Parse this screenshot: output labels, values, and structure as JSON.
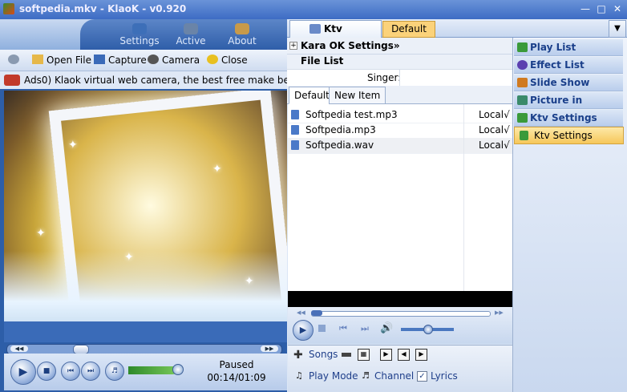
{
  "window": {
    "title": "softpedia.mkv - KlaoK - v0.920"
  },
  "nav_tabs": [
    {
      "label": "Settings"
    },
    {
      "label": "Active"
    },
    {
      "label": "About"
    }
  ],
  "toolbar": {
    "open_file": "Open File",
    "capture": "Capture",
    "camera": "Camera",
    "close": "Close"
  },
  "ad_text": "Ads0) Klaok virtual web camera, the best free make beauty sof",
  "playback": {
    "state": "Paused",
    "time": "00:14/01:09",
    "seek_fraction": 0.2,
    "volume_fraction": 0.85
  },
  "ktv_panel": {
    "tab_label": "Ktv Settings",
    "preset_label": "Default (0)",
    "section_kara": "Kara OK Settings»",
    "section_filelist": "File List",
    "singer_label": "Singer:",
    "singer_value": "",
    "list_tabs": [
      "Default",
      "New Item"
    ],
    "files": [
      {
        "name": "Softpedia test.mp3",
        "source": "Local√"
      },
      {
        "name": "Softpedia.mp3",
        "source": "Local√"
      },
      {
        "name": "Softpedia.wav",
        "source": "Local√"
      }
    ],
    "mini_volume_fraction": 0.5,
    "bottom": {
      "songs": "Songs",
      "play_mode": "Play Mode",
      "channel": "Channel",
      "lyrics": "Lyrics",
      "lyrics_checked": true
    }
  },
  "side_menu": [
    {
      "label": "Play List",
      "icon": "playlist-icon",
      "color": "#3a9a3a"
    },
    {
      "label": "Effect List",
      "icon": "effect-icon",
      "color": "#5b3fb0"
    },
    {
      "label": "Slide Show",
      "icon": "slideshow-icon",
      "color": "#d07a20"
    },
    {
      "label": "Picture in Picture",
      "icon": "pip-icon",
      "color": "#3a8a6a"
    },
    {
      "label": "Ktv Settings",
      "icon": "ktv-icon",
      "color": "#3a9a3a"
    }
  ],
  "side_selected": "Ktv Settings"
}
